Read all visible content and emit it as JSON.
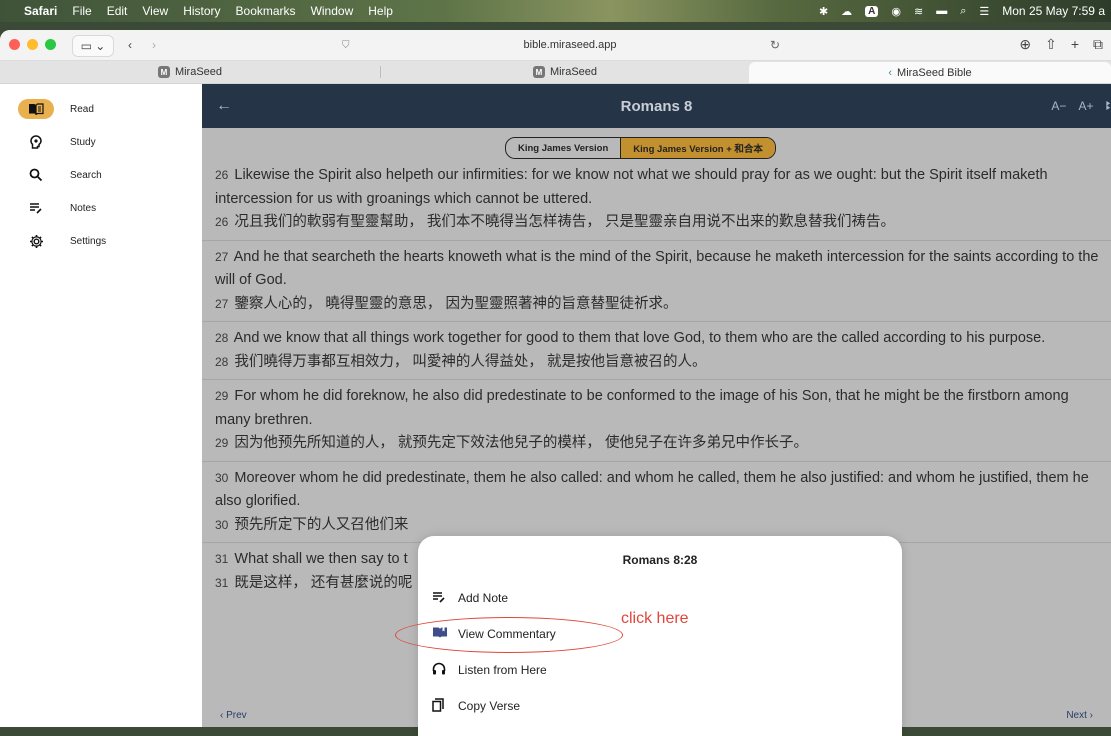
{
  "menubar": {
    "items": [
      "Safari",
      "File",
      "Edit",
      "View",
      "History",
      "Bookmarks",
      "Window",
      "Help"
    ],
    "status_a": "A",
    "datetime": "Mon 25 May  7:59 a"
  },
  "browser": {
    "url": "bible.miraseed.app",
    "tabs": [
      {
        "label": "MiraSeed",
        "favicon": "M"
      },
      {
        "label": "MiraSeed",
        "favicon": "M"
      },
      {
        "label": "MiraSeed Bible",
        "favicon": "‹"
      }
    ]
  },
  "sidebar": {
    "items": [
      {
        "label": "Read",
        "icon": "book-icon",
        "active": true
      },
      {
        "label": "Study",
        "icon": "lightbulb-head-icon"
      },
      {
        "label": "Search",
        "icon": "search-icon"
      },
      {
        "label": "Notes",
        "icon": "notes-icon"
      },
      {
        "label": "Settings",
        "icon": "gear-icon"
      }
    ]
  },
  "header": {
    "back_glyph": "←",
    "title": "Romans 8",
    "font_decrease": "A−",
    "font_increase": "A+"
  },
  "versions": {
    "options": [
      "King James Version",
      "King James Version + 和合本"
    ],
    "selected_index": 1
  },
  "verses": [
    {
      "num": "26",
      "en": "Likewise the Spirit also helpeth our infirmities: for we know not what we should pray for as we ought: but the Spirit itself maketh intercession for us with groanings which cannot be uttered.",
      "cn": "况且我们的軟弱有聖靈幫助， 我们本不曉得当怎样祷告， 只是聖靈亲自用说不出来的歎息替我们祷告。"
    },
    {
      "num": "27",
      "en": "And he that searcheth the hearts knoweth what is the mind of the Spirit, because he maketh intercession for the saints according to the will of God.",
      "cn": "鑒察人心的， 曉得聖靈的意思， 因为聖靈照著神的旨意替聖徒祈求。"
    },
    {
      "num": "28",
      "en": "And we know that all things work together for good to them that love God, to them who are the called according to his purpose.",
      "cn": "我们曉得万事都互相效力， 叫愛神的人得益处， 就是按他旨意被召的人。"
    },
    {
      "num": "29",
      "en": "For whom he did foreknow, he also did predestinate to be conformed to the image of his Son, that he might be the firstborn among many brethren.",
      "cn": "因为他预先所知道的人， 就预先定下效法他兒子的模样， 使他兒子在许多弟兄中作长子。"
    },
    {
      "num": "30",
      "en": "Moreover whom he did predestinate, them he also called: and whom he called, them he also justified: and whom he justified, them he also glorified.",
      "cn": "预先所定下的人又召他们来"
    },
    {
      "num": "31",
      "en": "What shall we then say to t",
      "cn": "既是这样， 还有甚麼说的呢"
    }
  ],
  "footer": {
    "prev": "‹  Prev",
    "next": "Next  ›"
  },
  "popup": {
    "title": "Romans 8:28",
    "items": [
      {
        "label": "Add Note",
        "icon": "notes-icon"
      },
      {
        "label": "View Commentary",
        "icon": "book-open-icon"
      },
      {
        "label": "Listen from Here",
        "icon": "headphones-icon"
      },
      {
        "label": "Copy Verse",
        "icon": "copy-icon"
      }
    ]
  },
  "annotation": {
    "text": "click here",
    "color": "#e0463a"
  },
  "colors": {
    "header_bg": "#253447",
    "accent_gold": "#e8b04f",
    "version_selected": "#c2902e"
  }
}
